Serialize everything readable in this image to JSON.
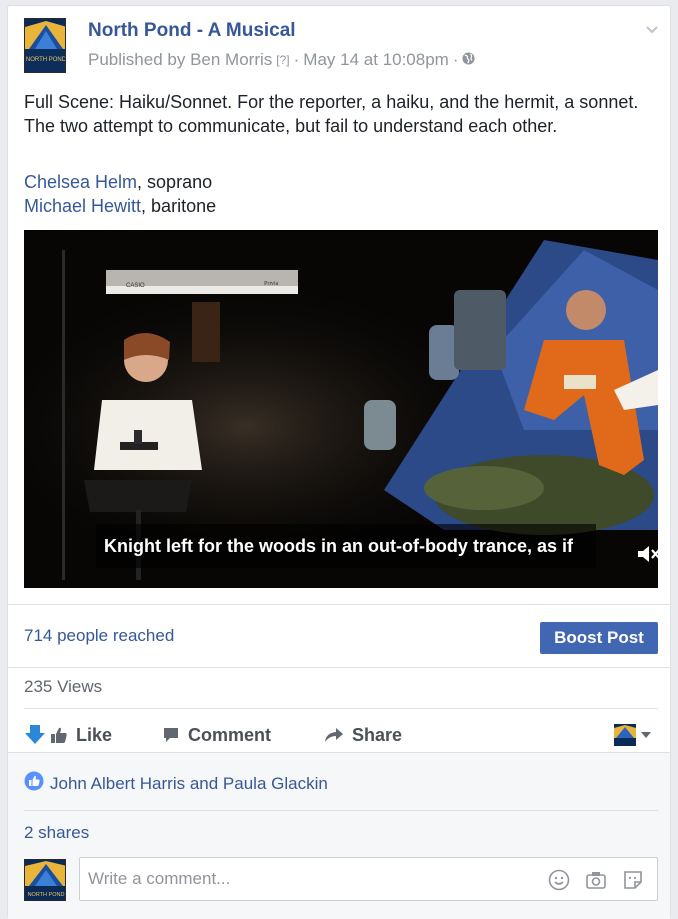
{
  "post": {
    "page_name": "North Pond - A Musical",
    "published_by": "Published by Ben Morris",
    "qmark": "[?]",
    "separator1": "·",
    "date": "May 14 at 10:08pm",
    "separator2": "·",
    "visibility_icon": "globe-icon",
    "text": "Full Scene: Haiku/Sonnet. For the reporter, a haiku, and the hermit, a sonnet. The two attempt to communicate, but fail to understand each other.",
    "credits": [
      {
        "name": "Chelsea Helm",
        "role": ", soprano"
      },
      {
        "name": "Michael Hewitt",
        "role": ", baritone"
      }
    ]
  },
  "video": {
    "caption": "Knight left for the woods in an out-of-body trance, as if",
    "mute_icon": "mute-icon",
    "keyboard_brand": "CASIO",
    "keyboard_model": "Privia"
  },
  "insights": {
    "reached": "714 people reached",
    "boost_label": "Boost Post",
    "views": "235 Views"
  },
  "actions": {
    "like": "Like",
    "comment": "Comment",
    "share": "Share"
  },
  "social": {
    "likers": "John Albert Harris and Paula Glackin",
    "shares": "2 shares",
    "comment_placeholder": "Write a comment..."
  },
  "avatar_text": "NORTH POND",
  "colors": {
    "link": "#365899",
    "boost": "#4267b2",
    "meta": "#90949c"
  }
}
